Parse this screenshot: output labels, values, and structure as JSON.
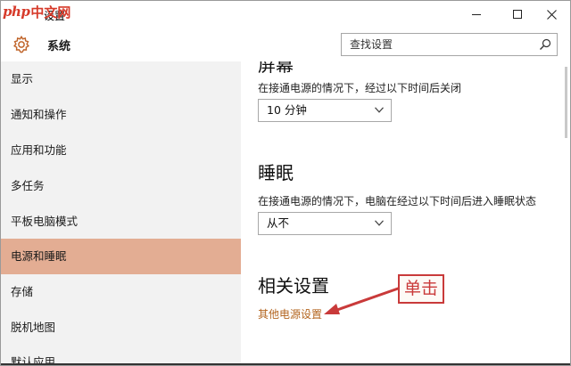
{
  "watermark": {
    "latin": "php",
    "cn": "中文网"
  },
  "window": {
    "title": "设置"
  },
  "header": {
    "section_title": "系统",
    "search_placeholder": "查找设置"
  },
  "sidebar": {
    "items": [
      {
        "label": "显示",
        "active": false
      },
      {
        "label": "通知和操作",
        "active": false
      },
      {
        "label": "应用和功能",
        "active": false
      },
      {
        "label": "多任务",
        "active": false
      },
      {
        "label": "平板电脑模式",
        "active": false
      },
      {
        "label": "电源和睡眠",
        "active": true
      },
      {
        "label": "存储",
        "active": false
      },
      {
        "label": "脱机地图",
        "active": false
      },
      {
        "label": "默认应用",
        "active": false
      }
    ]
  },
  "main": {
    "screen": {
      "description": "在接通电源的情况下，经过以下时间后关闭",
      "value": "10 分钟"
    },
    "sleep": {
      "heading": "睡眠",
      "description": "在接通电源的情况下，电脑在经过以下时间后进入睡眠状态",
      "value": "从不"
    },
    "related": {
      "heading": "相关设置",
      "link": "其他电源设置"
    }
  },
  "annotation": {
    "label": "单击",
    "color": "#c93a3a"
  },
  "colors": {
    "active_nav": "#e3ad93",
    "link": "#b3641e",
    "sidebar_bg": "#f2f2f2"
  }
}
